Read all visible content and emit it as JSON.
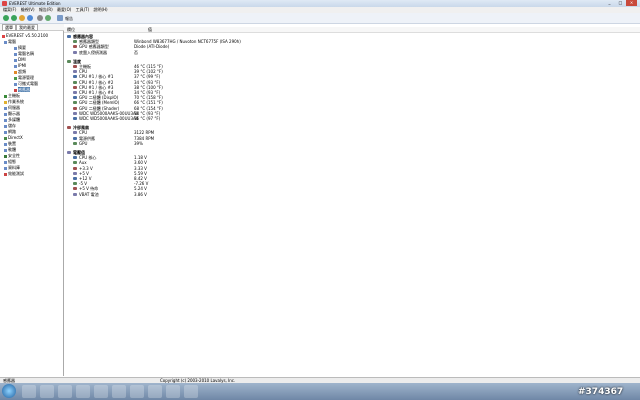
{
  "window": {
    "title": "EVEREST Ultimate Edition"
  },
  "menu": [
    "檔案(F)",
    "檢視(V)",
    "報告(R)",
    "最愛(O)",
    "工具(T)",
    "說明(H)"
  ],
  "toolbar": {
    "report_label": "報告"
  },
  "panel_tabs": [
    "選單",
    "我的最愛"
  ],
  "tree": [
    "EVEREST v5.50.2100",
    "電腦",
    "摘要",
    "電腦名稱",
    "DMI",
    "IPMI",
    "超頻",
    "電源管理",
    "可攜式電腦",
    "感應器",
    "主機板",
    "作業系統",
    "伺服器",
    "顯示器",
    "多媒體",
    "儲存",
    "網路",
    "DirectX",
    "裝置",
    "軟體",
    "安全性",
    "組態",
    "資料庫",
    "效能測試"
  ],
  "columns": {
    "field": "欄位",
    "value": "值"
  },
  "rows": [
    {
      "type": "sec",
      "field": "感應器內容"
    },
    {
      "field": "感應器類型",
      "value": "Winbond W83677HG / Nuvoton NCT6775F (ISA 290h)"
    },
    {
      "field": "GPU 感應器類型",
      "value": "Diode (ATI-Diode)"
    },
    {
      "field": "底盤入侵偵測器",
      "value": "否"
    },
    {
      "type": "gap"
    },
    {
      "type": "sec",
      "field": "溫度"
    },
    {
      "field": "主機板",
      "value": "46 °C (115 °F)"
    },
    {
      "field": "CPU",
      "value": "39 °C (102 °F)"
    },
    {
      "field": "CPU #1 / 核心 #1",
      "value": "37 °C (99 °F)"
    },
    {
      "field": "CPU #1 / 核心 #2",
      "value": "34 °C (93 °F)"
    },
    {
      "field": "CPU #1 / 核心 #3",
      "value": "38 °C (100 °F)"
    },
    {
      "field": "CPU #1 / 核心 #4",
      "value": "34 °C (93 °F)"
    },
    {
      "field": "GPU 二極體 (DispIO)",
      "value": "70 °C (158 °F)"
    },
    {
      "field": "GPU 二極體 (MemIO)",
      "value": "66 °C (151 °F)"
    },
    {
      "field": "GPU 二極體 (Shader)",
      "value": "68 °C (154 °F)"
    },
    {
      "field": "WDC WD5000AAKS-00UU3A0",
      "value": "34 °C (93 °F)"
    },
    {
      "field": "WDC WD5000AAKS-00UU3A0",
      "value": "36 °C (97 °F)"
    },
    {
      "type": "gap"
    },
    {
      "type": "sec",
      "field": "冷卻風扇"
    },
    {
      "field": "CPU",
      "value": "3122 RPM"
    },
    {
      "field": "電源供應",
      "value": "7384 RPM"
    },
    {
      "field": "GPU",
      "value": "39%"
    },
    {
      "type": "gap"
    },
    {
      "type": "sec",
      "field": "電壓值"
    },
    {
      "field": "CPU 核心",
      "value": "1.18 V"
    },
    {
      "field": "Aux",
      "value": "3.60 V"
    },
    {
      "field": "+3.3 V",
      "value": "3.33 V"
    },
    {
      "field": "+5 V",
      "value": "5.59 V"
    },
    {
      "field": "+12 V",
      "value": "8.42 V"
    },
    {
      "field": "-5 V",
      "value": "-7.26 V"
    },
    {
      "field": "+5 V 待命",
      "value": "5.24 V"
    },
    {
      "field": "VBAT 電池",
      "value": "3.86 V"
    }
  ],
  "status": {
    "left": "感應器",
    "center": "Copyright (c) 2003-2010 Lavalys, Inc."
  },
  "watermark": "#374367",
  "colors": {
    "accent": "#3a6ea5"
  }
}
